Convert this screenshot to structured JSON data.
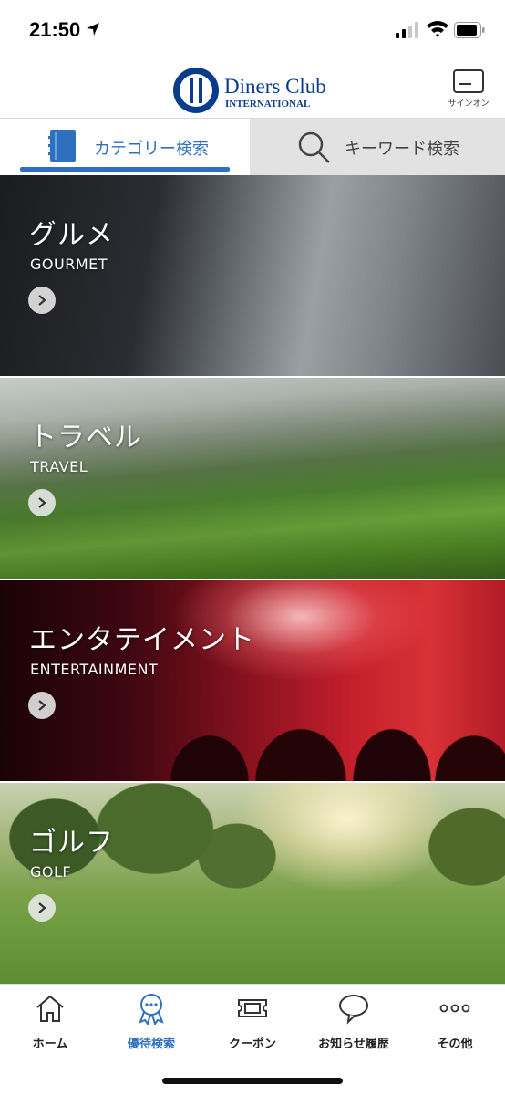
{
  "status_bar": {
    "time": "21:50"
  },
  "header": {
    "brand_line1": "Diners Club",
    "brand_line2": "INTERNATIONAL",
    "signon_label": "サインオン"
  },
  "tabs": {
    "category": "カテゴリー検索",
    "keyword": "キーワード検索"
  },
  "categories": [
    {
      "title": "グルメ",
      "subtitle": "GOURMET"
    },
    {
      "title": "トラベル",
      "subtitle": "TRAVEL"
    },
    {
      "title": "エンタテイメント",
      "subtitle": "ENTERTAINMENT"
    },
    {
      "title": "ゴルフ",
      "subtitle": "GOLF"
    }
  ],
  "bottom_nav": [
    {
      "label": "ホーム",
      "icon": "home-icon"
    },
    {
      "label": "優待検索",
      "icon": "badge-icon"
    },
    {
      "label": "クーポン",
      "icon": "ticket-icon"
    },
    {
      "label": "お知らせ履歴",
      "icon": "speech-bubble-icon"
    },
    {
      "label": "その他",
      "icon": "more-icon"
    }
  ],
  "colors": {
    "accent": "#2e6fbe",
    "brand_blue": "#0a3c8c"
  }
}
